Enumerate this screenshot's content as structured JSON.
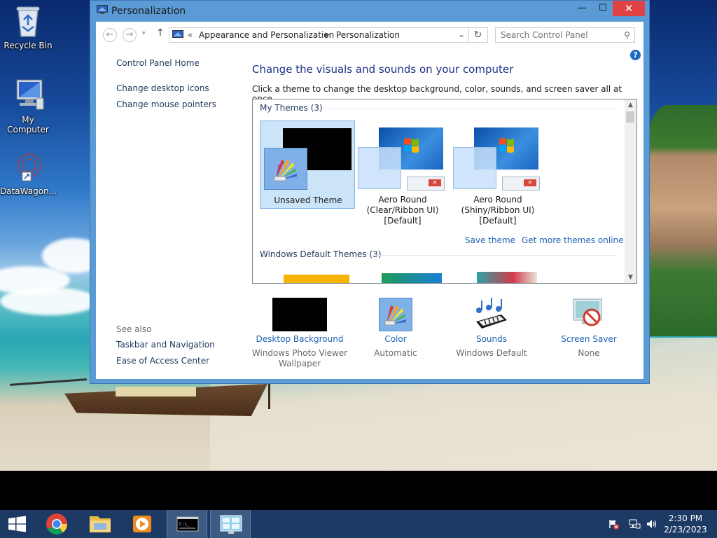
{
  "desktop": {
    "icons": [
      {
        "label": "Recycle Bin"
      },
      {
        "label": "My Computer"
      },
      {
        "label": "DataWagon..."
      }
    ]
  },
  "window": {
    "title": "Personalization",
    "controls": {
      "minimize": "—",
      "maximize": "☐",
      "close": "✕"
    },
    "address": {
      "root_sep": "«",
      "crumbs": [
        "Appearance and Personalization",
        "Personalization"
      ],
      "search_placeholder": "Search Control Panel"
    },
    "help": "?",
    "nav": {
      "home": "Control Panel Home",
      "links": [
        "Change desktop icons",
        "Change mouse pointers"
      ],
      "see_also_label": "See also",
      "see_also": [
        "Taskbar and Navigation",
        "Ease of Access Center"
      ]
    },
    "main": {
      "heading": "Change the visuals and sounds on your computer",
      "subtext": "Click a theme to change the desktop background, color, sounds, and screen saver all at once.",
      "my_themes_header": "My Themes (3)",
      "themes": [
        {
          "label_lines": [
            "Unsaved Theme"
          ],
          "selected": true
        },
        {
          "label_lines": [
            "Aero Round",
            "(Clear/Ribbon UI)",
            "[Default]"
          ],
          "selected": false
        },
        {
          "label_lines": [
            "Aero Round",
            "(Shiny/Ribbon UI)",
            "[Default]"
          ],
          "selected": false
        }
      ],
      "save_theme": "Save theme",
      "get_more": "Get more themes online",
      "windows_default_header": "Windows Default Themes (3)"
    },
    "quick_settings": [
      {
        "title": "Desktop Background",
        "value_lines": [
          "Windows Photo Viewer",
          "Wallpaper"
        ]
      },
      {
        "title": "Color",
        "value_lines": [
          "Automatic"
        ]
      },
      {
        "title": "Sounds",
        "value_lines": [
          "Windows Default"
        ]
      },
      {
        "title": "Screen Saver",
        "value_lines": [
          "None"
        ]
      }
    ]
  },
  "taskbar": {
    "time": "2:30 PM",
    "date": "2/23/2023"
  },
  "colors": {
    "window_frame": "#5b9bd5",
    "taskbar": "#1c3a63",
    "link": "#1e64b4",
    "heading": "#1e3287",
    "close_button": "#e04343",
    "selection": "#cce4f7"
  }
}
